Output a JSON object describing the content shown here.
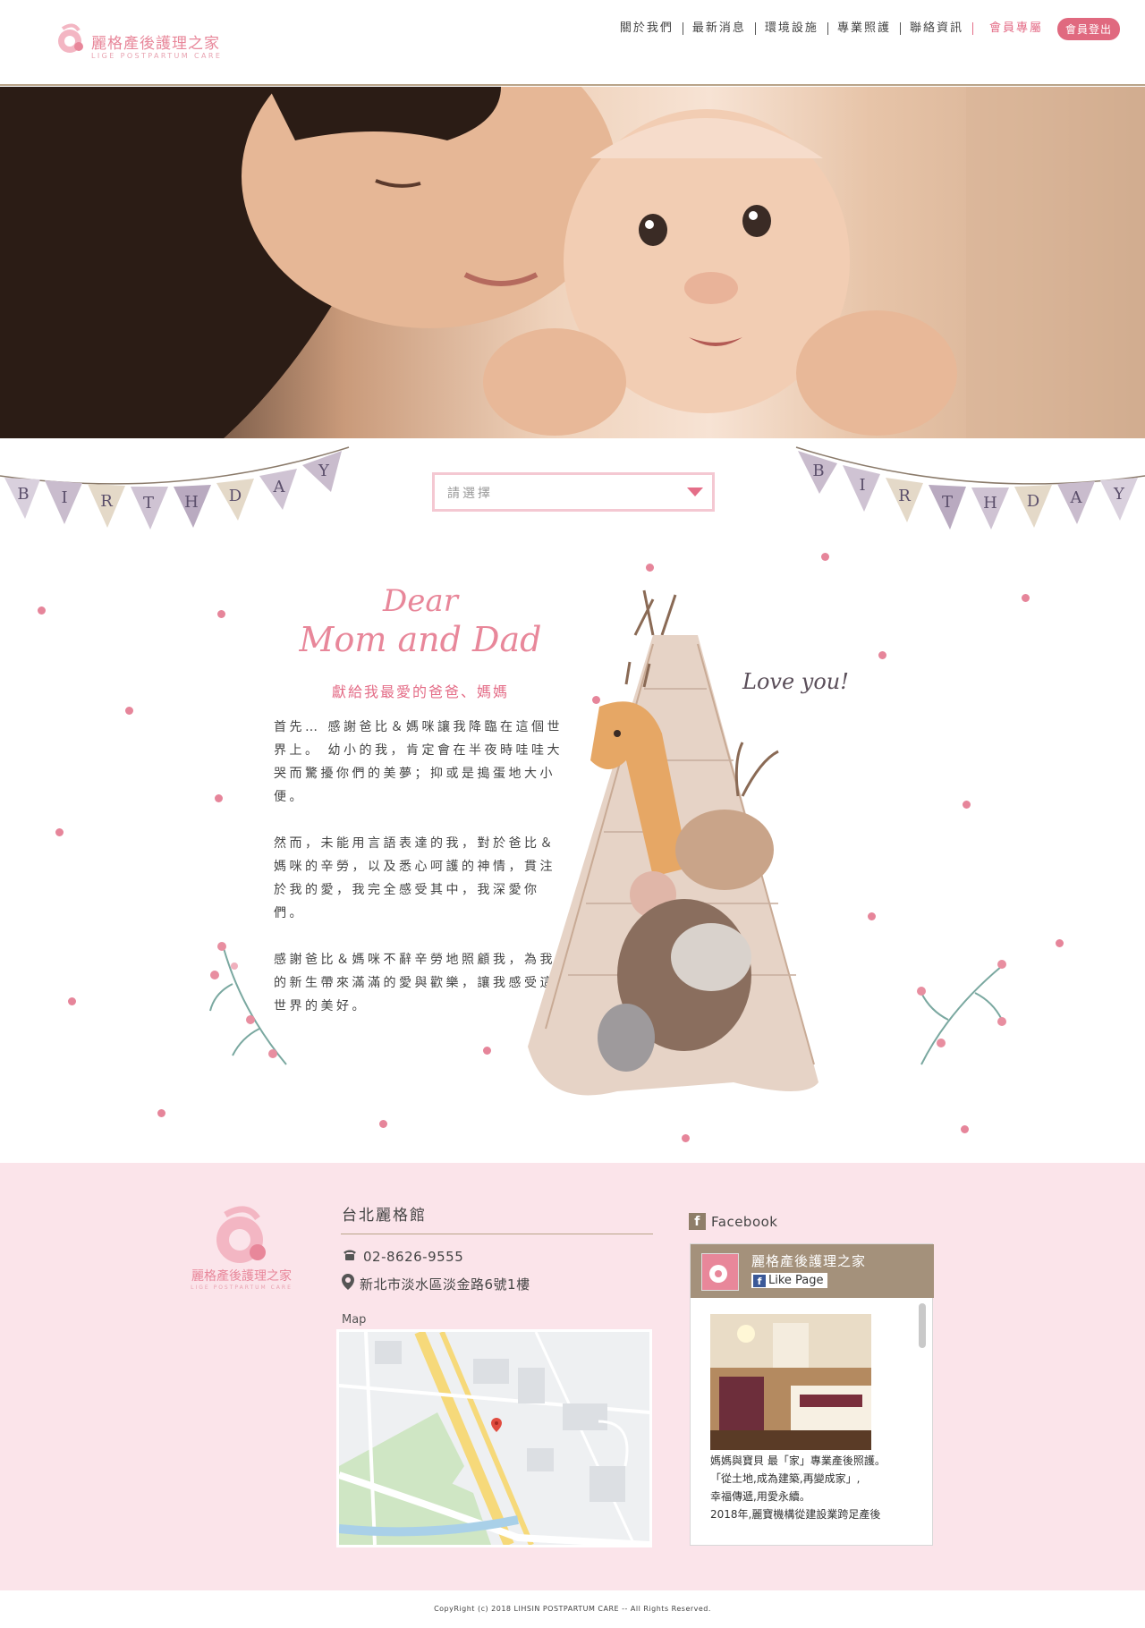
{
  "header": {
    "logo_name": "麗格產後護理之家",
    "logo_sub": "LIGE POSTPARTUM CARE",
    "nav": [
      "關於我們",
      "最新消息",
      "環境設施",
      "專業照護",
      "聯絡資訊"
    ],
    "member_label": "會員專屬",
    "logout_label": "會員登出",
    "accent_color": "#e46e88"
  },
  "hero": {
    "description": "mother smiling beside a baby"
  },
  "birthday": {
    "bunting_letters": [
      "B",
      "I",
      "R",
      "T",
      "H",
      "D",
      "A",
      "Y"
    ],
    "select_placeholder": "請選擇",
    "dear_line1": "Dear",
    "dear_line2": "Mom and Dad",
    "subtitle": "獻給我最愛的爸爸、媽媽",
    "paragraphs": [
      "首先… 感謝爸比＆媽咪讓我降臨在這個世界上。 幼小的我，肯定會在半夜時哇哇大哭而驚擾你們的美夢；抑或是搗蛋地大小便。",
      "然而，未能用言語表達的我，對於爸比＆媽咪的辛勞，以及悉心呵護的神情，貫注於我的愛，我完全感受其中，我深愛你們。",
      "感謝爸比＆媽咪不辭辛勞地照顧我，為我的新生帶來滿滿的愛與歡樂，讓我感受這世界的美好。"
    ],
    "love_you": "Love you!"
  },
  "footer": {
    "branch_title": "台北麗格館",
    "phone": "02-8626-9555",
    "address": "新北市淡水區淡金路6號1樓",
    "map_label": "Map",
    "logo_name": "麗格產後護理之家",
    "logo_sub": "LIGE POSTPARTUM CARE",
    "facebook_label": "Facebook",
    "fb_page_name": "麗格產後護理之家",
    "fb_like_label": "Like Page",
    "fb_post_lines": [
      "媽媽與寶貝 最「家」專業產後照護。",
      "「從土地,成為建築,再變成家」,",
      "幸福傳遞,用愛永續。",
      "2018年,麗寶機構從建設業跨足產後"
    ],
    "copyright": "CopyRight (c) 2018  LIHSIN POSTPARTUM CARE -- All Rights Reserved.",
    "bg_color": "#fbe4ea"
  }
}
